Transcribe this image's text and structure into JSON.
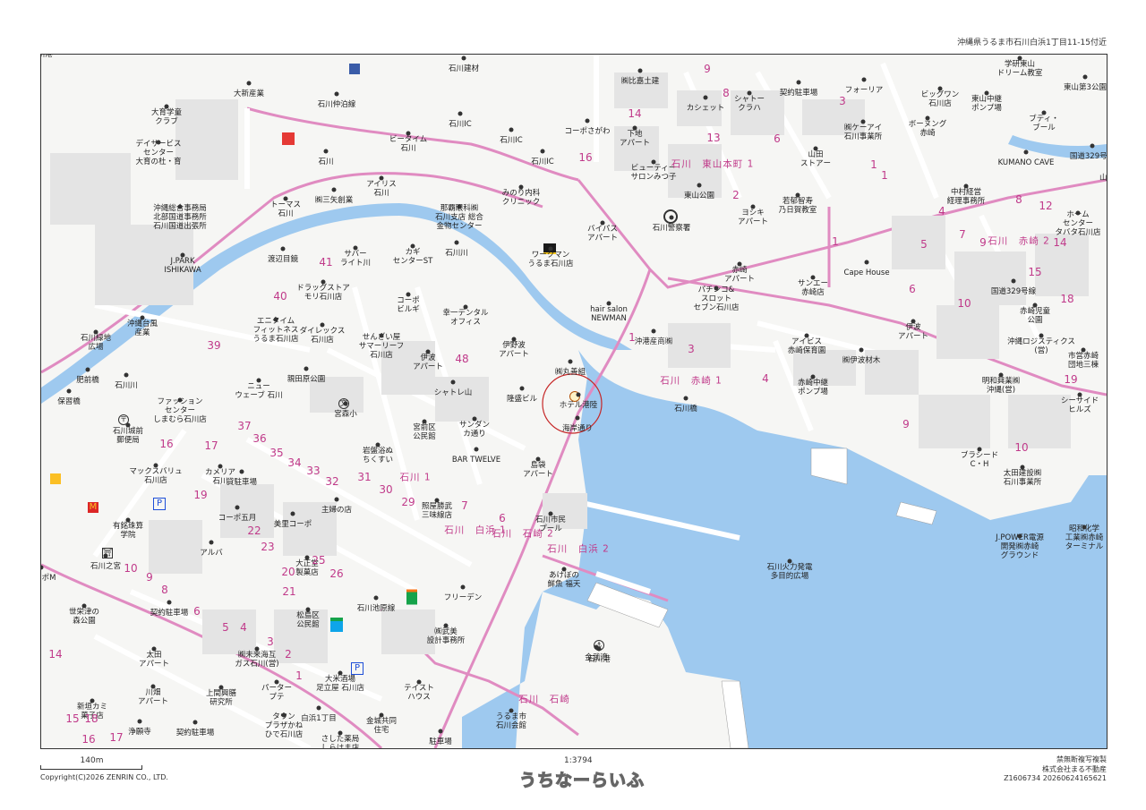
{
  "header": {
    "address": "沖縄県うるま市石川白浜1丁目11-15付近"
  },
  "map": {
    "colors": {
      "water": "#9ec9ef",
      "road_main": "#e08bc1",
      "road": "#ffffff",
      "block": "#e4e4e4",
      "text_district": "#c03a8a"
    },
    "districts": [
      "石川　東山本町 1",
      "石川　赤崎 1",
      "石川　赤崎 2",
      "石川　石崎 2",
      "石川　白浜 1",
      "石川　白浜 2",
      "石川 1",
      "石川　石崎"
    ],
    "places": [
      "大育学童\nクラブ",
      "大新産業",
      "ビータイム\n石川",
      "石川仲泊線",
      "石川IC",
      "石川IC",
      "石川IC",
      "石川建材",
      "石川",
      "デイサービス\nセンター\n大育の杜・育",
      "トーマス\n石川",
      "㈱三矢創業",
      "アイリス\n石川",
      "那覇眼科㈱\n石川支店 総合\n金物センター",
      "沖縄総合事務局\n北部国道事務所\n石川国道出張所",
      "J.PARK\nISHIKAWA",
      "渡辺目鏡",
      "サバー\nライト川",
      "カギ\nセンターST",
      "石川川",
      "ドラッグストア\nモリ石川店",
      "エニタイム\nフィットネス\nうるま石川店",
      "ダイレックス\n石川店",
      "コーポ\nビルギ",
      "幸一デンタル\nオフィス",
      "沖縄台風\n産業",
      "石川緑地\n広場",
      "肥前橋",
      "石川川",
      "保習橋",
      "せんざい屋\nサマーリーフ\n石川店",
      "伊波\nアパート",
      "伊野波\nアパート",
      "ニュー\nウェーブ 石川",
      "親田原公園",
      "宮森小",
      "シャトレ山",
      "隆盛ビル",
      "ホテル港陸",
      "海岸通り",
      "ファッション\nセンター\nしまむら石川店",
      "石川城前\n郵便局",
      "マックスバリュ\n石川店",
      "岩盤浴ぬ\nちくすい",
      "宮前区\n公民館",
      "サンダン\nカ通り",
      "BAR TWELVE",
      "島袋\nアパート",
      "カメリア\n石川",
      "貸駐車場",
      "コーポ五月",
      "美里コーポ",
      "主婦の店",
      "照屋勝武\n三味線店",
      "石川市民\nプール",
      "有銘珠算\n学院",
      "石川之宮",
      "アルバ",
      "大正堂\n製菓店",
      "コーポM",
      "世栄津の\n森公園",
      "契約駐車場",
      "あけぼの\n鮮魚 福天",
      "フリーデン",
      "石川池原線",
      "松島区\n公民館",
      "㈱武美\n設計事務所",
      "太田\nアパート",
      "㈱未来海互\nガス石川(営)",
      "大米酒場\n足立屋 石川店",
      "パーター\nプテ",
      "テイスト\nハウス",
      "石川港",
      "新垣カミ\n菓子店",
      "川畑\nアパート",
      "上間興膳\n研究所",
      "タウン\nプラザかね\nひで石川店",
      "白浜1丁目",
      "金城共同\n住宅",
      "うるま市\n石川会館",
      "浄願寺",
      "契約駐車場",
      "さした薬局\nしらはま店",
      "駐車場",
      "㈱比嘉土建",
      "カシェット",
      "シャトー\nクラハ",
      "契約駐車場",
      "フォーリア",
      "学研東山\nドリーム教室",
      "ビッグワン\n石川店",
      "東山中継\nポンプ場",
      "東山第3公園",
      "コーポさがわ",
      "下地\nアパート",
      "ビューティー\nサロンみつ子",
      "みのり内科\nクリニック",
      "東山公園",
      "山田\nストアー",
      "㈱ケーアイ\n石川事業所",
      "ボーヌング\n赤崎",
      "ブティ・\nブール",
      "KUMANO CAVE",
      "国道329号線",
      "山城飯金",
      "ワークマン\nうるま石川店",
      "バイパス\nアパート",
      "石川警察署",
      "ヨシキ\nアパート",
      "若郁智寿\n乃日賀教室",
      "中村経営\n経理事務所",
      "ホーム\nセンター\nタバタ石川店",
      "Cape House",
      "サンエー\n赤崎店",
      "パチンコ&\nスロット\nセブン石川店",
      "赤崎\nアパート",
      "国道329号線",
      "赤崎児童\n公園",
      "hair salon\nNEWMAN",
      "沖港産商㈱",
      "伊波\nアパート",
      "沖縄ロジスティクス\n(営)",
      "市営赤崎\n団地三棟",
      "アイビス\n赤崎保育園",
      "㈱伊波材木",
      "㈱丸善組",
      "石川橋",
      "赤崎中継\nポンプ場",
      "明和興業㈱\n沖縄(営)",
      "シーサイド\nヒルズ",
      "ブラシード\nC・H",
      "太田建設㈱\n石川事業所",
      "J.POWER電源\n開発㈱赤崎\nグラウンド",
      "昭和化学\n工業㈱赤崎\nターミナル",
      "石川火力発電\n多目的広場",
      "金武湾",
      "石川港"
    ],
    "blocks": [
      "9",
      "8",
      "14",
      "13",
      "6",
      "16",
      "1",
      "3",
      "2",
      "1",
      "4",
      "8",
      "12",
      "7",
      "9",
      "14",
      "5",
      "15",
      "1",
      "6",
      "18",
      "10",
      "19",
      "41",
      "40",
      "39",
      "48",
      "1",
      "3",
      "4",
      "9",
      "10",
      "37",
      "36",
      "35",
      "34",
      "33",
      "32",
      "31",
      "30",
      "29",
      "7",
      "6",
      "16",
      "17",
      "19",
      "22",
      "23",
      "25",
      "26",
      "21",
      "20",
      "10",
      "9",
      "8",
      "6",
      "5",
      "4",
      "3",
      "2",
      "1",
      "14",
      "17",
      "16",
      "18",
      "15"
    ]
  },
  "footer": {
    "scale_label": "140m",
    "copyright": "Copyright(C)2026 ZENRIN CO., LTD.",
    "ratio": "1:3794",
    "logo": "うちなーらいふ",
    "right": [
      "禁無断複写複製",
      "株式会社まる不動産",
      "Z1606734 20260624165621"
    ]
  }
}
